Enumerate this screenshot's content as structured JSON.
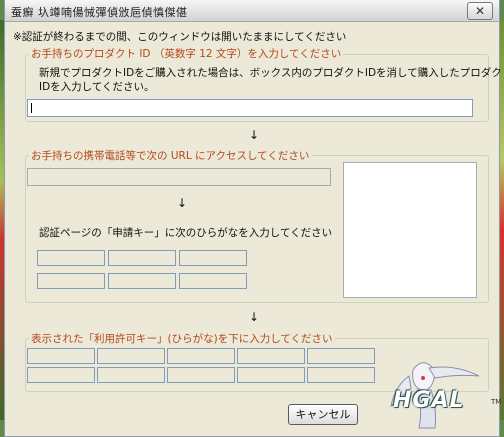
{
  "window": {
    "title": "蚕癬 圦竴喃偒悈彈偵攽巵偵慎傑偡",
    "close_glyph": "✕"
  },
  "notice": "※認証が終わるまでの間、このウィンドウは開いたままにしてください",
  "product_section": {
    "label": "お手持ちのプロダクト ID （英数字 12 文字）を入力してください",
    "description_line1": "新規でプロダクトIDをご購入された場合は、ボックス内のプロダクトIDを消して購入したプロダクト",
    "description_line2": "IDを入力してください。",
    "input_value": ""
  },
  "arrow_glyph": "↓",
  "url_section": {
    "label": "お手持ちの携帯電話等で次の URL にアクセスしてください",
    "url_value": "",
    "request_key_label": "認証ページの「申請キー」に次のひらがなを入力してください",
    "request_key_cells": [
      "",
      "",
      "",
      "",
      "",
      ""
    ]
  },
  "license_section": {
    "label": "表示された「利用許可キー」(ひらがな)を下に入力してください",
    "key_cells": [
      "",
      "",
      "",
      "",
      "",
      "",
      "",
      "",
      "",
      ""
    ]
  },
  "cancel_label": "キャンセル",
  "logo": {
    "text": "HGAL",
    "tm": "TM"
  },
  "colors": {
    "section_label": "#b4471a",
    "window_bg": "#ece9d8",
    "input_border": "#7f9db9"
  }
}
